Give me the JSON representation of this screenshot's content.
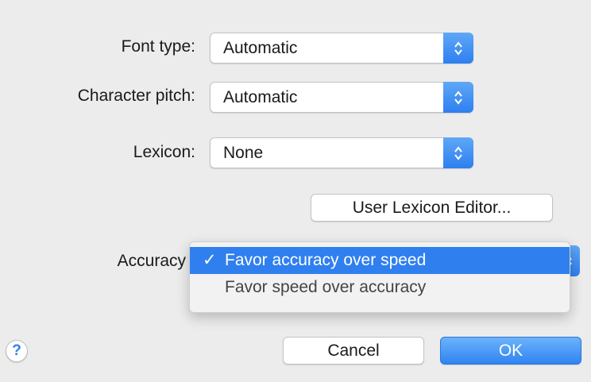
{
  "fields": {
    "font_type": {
      "label": "Font type:",
      "value": "Automatic"
    },
    "character_pitch": {
      "label": "Character pitch:",
      "value": "Automatic"
    },
    "lexicon": {
      "label": "Lexicon:",
      "value": "None"
    },
    "accuracy": {
      "label": "Accuracy"
    }
  },
  "user_lexicon_button": "User Lexicon Editor...",
  "accuracy_menu": {
    "check_mark": "✓",
    "items": [
      {
        "label": "Favor accuracy over speed",
        "selected": true
      },
      {
        "label": "Favor speed over accuracy",
        "selected": false
      }
    ]
  },
  "buttons": {
    "help": "?",
    "cancel": "Cancel",
    "ok": "OK"
  },
  "colors": {
    "accent": "#2f7fef",
    "background": "#ececec"
  },
  "icons": {
    "stepper": "up-down-chevron-icon",
    "help": "help-icon"
  }
}
